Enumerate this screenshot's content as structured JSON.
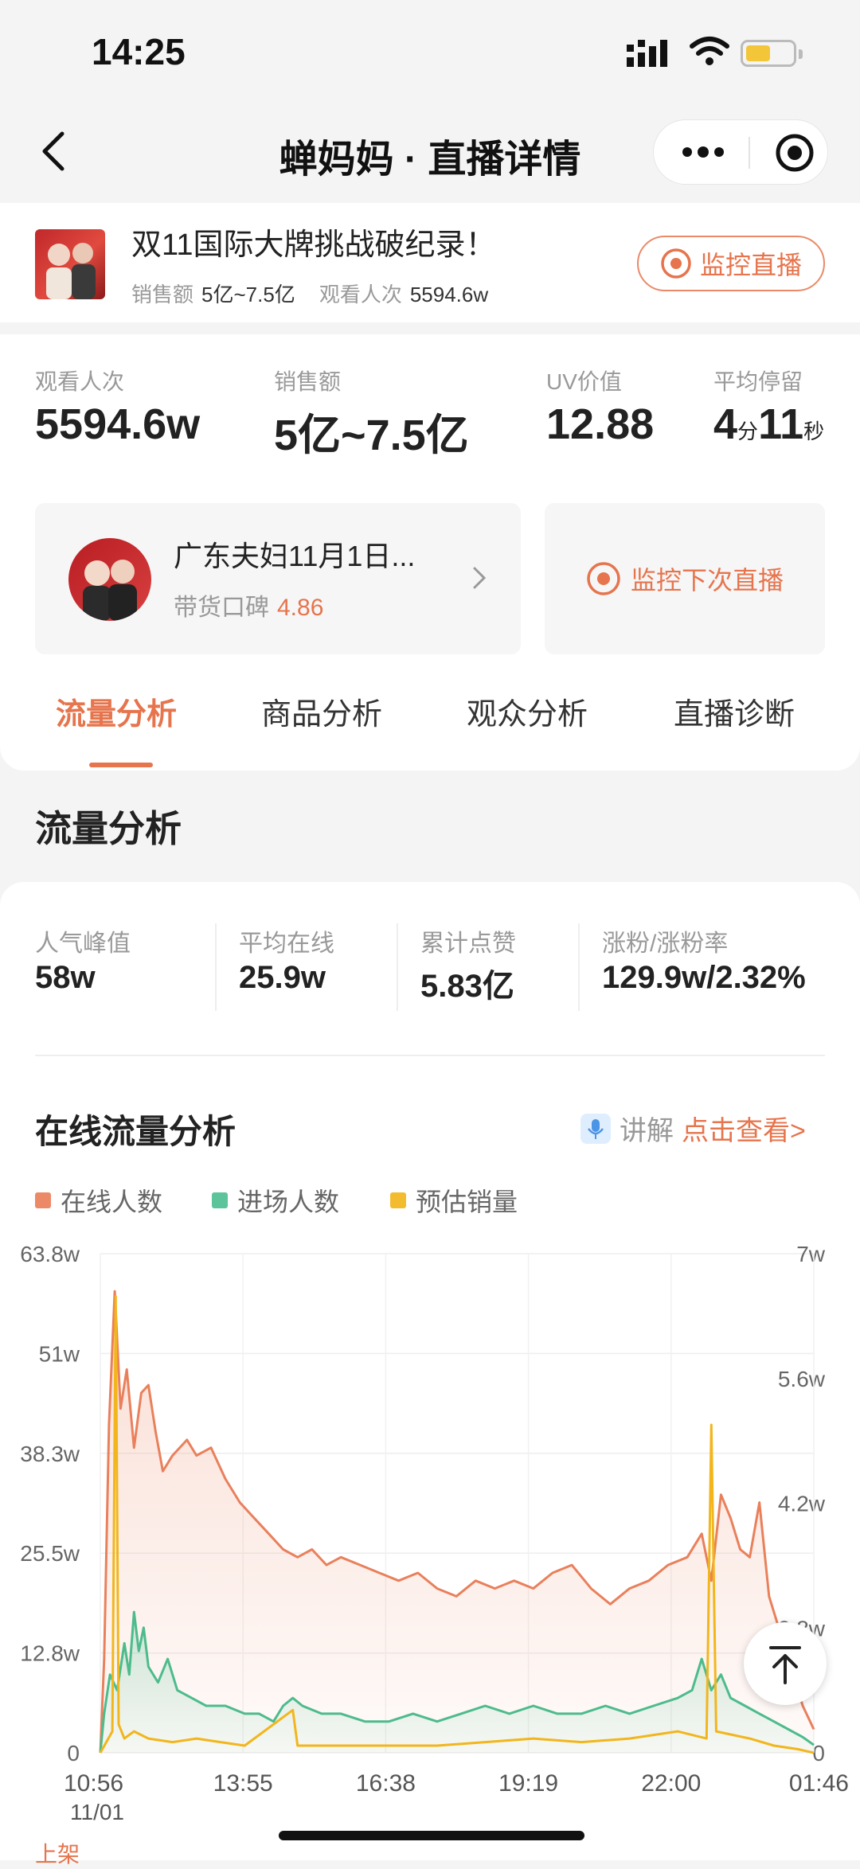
{
  "status_bar": {
    "time": "14:25"
  },
  "nav": {
    "title": "蝉妈妈 · 直播详情"
  },
  "live": {
    "title": "双11国际大牌挑战破纪录！",
    "sales_label": "销售额",
    "sales_value": "5亿~7.5亿",
    "views_label": "观看人次",
    "views_value": "5594.6w",
    "monitor_button": "监控直播"
  },
  "stats": [
    {
      "label": "观看人次",
      "value": "5594.6w"
    },
    {
      "label": "销售额",
      "value": "5亿~7.5亿"
    },
    {
      "label": "UV价值",
      "value": "12.88"
    },
    {
      "label": "平均停留",
      "minutes": "4",
      "minutes_unit": "分",
      "seconds": "11",
      "seconds_unit": "秒"
    }
  ],
  "anchor": {
    "name": "广东夫妇11月1日...",
    "reputation_label": "带货口碑",
    "reputation_value": "4.86"
  },
  "next_live_button": "监控下次直播",
  "tabs": [
    "流量分析",
    "商品分析",
    "观众分析",
    "直播诊断"
  ],
  "active_tab": 0,
  "section_title": "流量分析",
  "metrics": [
    {
      "label": "人气峰值",
      "value": "58w"
    },
    {
      "label": "平均在线",
      "value": "25.9w"
    },
    {
      "label": "累计点赞",
      "value": "5.83亿"
    },
    {
      "label": "涨粉/涨粉率",
      "value": "129.9w/2.32%"
    }
  ],
  "chart_section": {
    "title": "在线流量分析",
    "explain_label": "讲解",
    "explain_link": "点击查看>"
  },
  "bottom_label": "上架",
  "colors": {
    "accent": "#e6744c",
    "online": "#ec8a68",
    "entry": "#5cc49a",
    "sales": "#f3bc2e"
  },
  "chart_data": {
    "type": "line",
    "legend": [
      "在线人数",
      "进场人数",
      "预估销量"
    ],
    "x_ticks": [
      "10:56",
      "13:55",
      "16:38",
      "19:19",
      "22:00",
      "01:46"
    ],
    "x_sub_label": "11/01",
    "y_left_ticks": [
      "63.8w",
      "51w",
      "38.3w",
      "25.5w",
      "12.8w",
      "0"
    ],
    "y_right_ticks": [
      "7w",
      "5.6w",
      "4.2w",
      "2.8w",
      "0"
    ],
    "y_left_range": [
      0,
      63.8
    ],
    "y_right_range": [
      0,
      7
    ],
    "x_range_hours": [
      0,
      14.83
    ],
    "series": [
      {
        "name": "在线人数",
        "axis": "left",
        "points": [
          [
            0,
            0
          ],
          [
            0.08,
            12
          ],
          [
            0.18,
            42
          ],
          [
            0.3,
            59
          ],
          [
            0.42,
            44
          ],
          [
            0.55,
            49
          ],
          [
            0.7,
            39
          ],
          [
            0.85,
            46
          ],
          [
            1.0,
            47
          ],
          [
            1.15,
            41
          ],
          [
            1.3,
            36
          ],
          [
            1.5,
            38
          ],
          [
            1.8,
            40
          ],
          [
            2.0,
            38
          ],
          [
            2.3,
            39
          ],
          [
            2.6,
            35
          ],
          [
            2.9,
            32
          ],
          [
            3.2,
            30
          ],
          [
            3.5,
            28
          ],
          [
            3.8,
            26
          ],
          [
            4.1,
            25
          ],
          [
            4.4,
            26
          ],
          [
            4.7,
            24
          ],
          [
            5.0,
            25
          ],
          [
            5.4,
            24
          ],
          [
            5.8,
            23
          ],
          [
            6.2,
            22
          ],
          [
            6.6,
            23
          ],
          [
            7.0,
            21
          ],
          [
            7.4,
            20
          ],
          [
            7.8,
            22
          ],
          [
            8.2,
            21
          ],
          [
            8.6,
            22
          ],
          [
            9.0,
            21
          ],
          [
            9.4,
            23
          ],
          [
            9.8,
            24
          ],
          [
            10.2,
            21
          ],
          [
            10.6,
            19
          ],
          [
            11.0,
            21
          ],
          [
            11.4,
            22
          ],
          [
            11.8,
            24
          ],
          [
            12.2,
            25
          ],
          [
            12.5,
            28
          ],
          [
            12.7,
            22
          ],
          [
            12.9,
            33
          ],
          [
            13.1,
            30
          ],
          [
            13.3,
            26
          ],
          [
            13.5,
            25
          ],
          [
            13.7,
            32
          ],
          [
            13.9,
            20
          ],
          [
            14.1,
            16
          ],
          [
            14.4,
            10
          ],
          [
            14.6,
            6
          ],
          [
            14.83,
            3
          ]
        ]
      },
      {
        "name": "进场人数",
        "axis": "left",
        "points": [
          [
            0,
            0
          ],
          [
            0.08,
            5
          ],
          [
            0.2,
            10
          ],
          [
            0.35,
            8
          ],
          [
            0.5,
            14
          ],
          [
            0.6,
            10
          ],
          [
            0.7,
            18
          ],
          [
            0.8,
            13
          ],
          [
            0.9,
            16
          ],
          [
            1.0,
            11
          ],
          [
            1.2,
            9
          ],
          [
            1.4,
            12
          ],
          [
            1.6,
            8
          ],
          [
            1.9,
            7
          ],
          [
            2.2,
            6
          ],
          [
            2.6,
            6
          ],
          [
            3.0,
            5
          ],
          [
            3.3,
            5
          ],
          [
            3.6,
            4
          ],
          [
            3.8,
            6
          ],
          [
            4.0,
            7
          ],
          [
            4.2,
            6
          ],
          [
            4.6,
            5
          ],
          [
            5.0,
            5
          ],
          [
            5.5,
            4
          ],
          [
            6.0,
            4
          ],
          [
            6.5,
            5
          ],
          [
            7.0,
            4
          ],
          [
            7.5,
            5
          ],
          [
            8.0,
            6
          ],
          [
            8.5,
            5
          ],
          [
            9.0,
            6
          ],
          [
            9.5,
            5
          ],
          [
            10.0,
            5
          ],
          [
            10.5,
            6
          ],
          [
            11.0,
            5
          ],
          [
            11.5,
            6
          ],
          [
            12.0,
            7
          ],
          [
            12.3,
            8
          ],
          [
            12.5,
            12
          ],
          [
            12.7,
            8
          ],
          [
            12.9,
            10
          ],
          [
            13.1,
            7
          ],
          [
            13.4,
            6
          ],
          [
            13.7,
            5
          ],
          [
            14.0,
            4
          ],
          [
            14.3,
            3
          ],
          [
            14.6,
            2
          ],
          [
            14.83,
            1
          ]
        ]
      },
      {
        "name": "预估销量",
        "axis": "right",
        "points": [
          [
            0,
            0
          ],
          [
            0.25,
            0.3
          ],
          [
            0.32,
            6.4
          ],
          [
            0.38,
            0.4
          ],
          [
            0.5,
            0.2
          ],
          [
            0.7,
            0.3
          ],
          [
            1.0,
            0.2
          ],
          [
            1.5,
            0.15
          ],
          [
            2.0,
            0.2
          ],
          [
            2.5,
            0.15
          ],
          [
            3.0,
            0.1
          ],
          [
            4.0,
            0.6
          ],
          [
            4.1,
            0.1
          ],
          [
            5.0,
            0.1
          ],
          [
            6.0,
            0.1
          ],
          [
            7.0,
            0.1
          ],
          [
            8.0,
            0.15
          ],
          [
            9.0,
            0.2
          ],
          [
            10.0,
            0.15
          ],
          [
            11.0,
            0.2
          ],
          [
            12.0,
            0.3
          ],
          [
            12.6,
            0.2
          ],
          [
            12.7,
            4.6
          ],
          [
            12.8,
            0.3
          ],
          [
            13.5,
            0.2
          ],
          [
            14.0,
            0.1
          ],
          [
            14.5,
            0.05
          ],
          [
            14.83,
            0
          ]
        ]
      }
    ]
  }
}
